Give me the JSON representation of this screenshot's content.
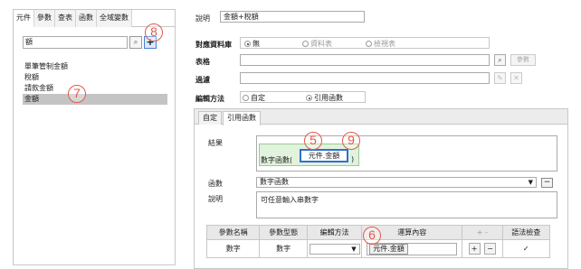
{
  "left_panel": {
    "tabs": [
      "元件",
      "參數",
      "查表",
      "函數",
      "全域變數"
    ],
    "search": {
      "value": "額"
    },
    "items": [
      "單筆管制金額",
      "稅額",
      "請款金額",
      "金額"
    ]
  },
  "annotations": [
    "5",
    "6",
    "7",
    "8",
    "9"
  ],
  "top_form": {
    "description_label": "說明",
    "description_value": "金額+稅額",
    "db_label": "對應資料庫",
    "db_options": [
      "無",
      "資料表",
      "檢視表"
    ],
    "table_label": "表格",
    "param_button": "參數",
    "filter_label": "過濾",
    "edit_label": "編輯方法",
    "edit_options": [
      "自定",
      "引用函數"
    ]
  },
  "panel": {
    "tabs": [
      "自定",
      "引用函數"
    ],
    "result_label": "結果",
    "formula": {
      "fname": "數字函數(",
      "chip": "元件.金額",
      "close": ")"
    },
    "function_label": "函數",
    "function_value": "數字函數",
    "desc_label": "說明",
    "desc_value": "可任意輸入串數字",
    "table": {
      "headers": [
        "參數名稱",
        "參數型態",
        "編輯方法",
        "運算內容",
        "+ -",
        "語法檢查"
      ],
      "row": {
        "name": "數字",
        "type": "數字",
        "content_chip": "元件.金額",
        "check": "✓"
      }
    }
  }
}
